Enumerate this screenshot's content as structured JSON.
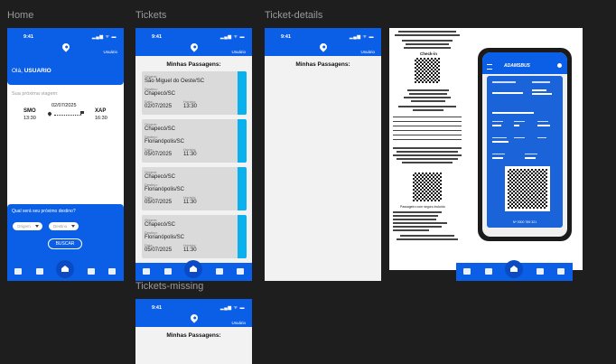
{
  "frames": {
    "home": "Home",
    "tickets": "Tickets",
    "ticket_details": "Ticket-details",
    "tickets_missing": "Tickets-missing"
  },
  "status": {
    "time": "9:41",
    "icons": "▂▄▆ ᯤ ▬"
  },
  "header": {
    "user_label": "Usuário"
  },
  "home": {
    "greeting": "Olá,",
    "user_name": "USUARIO",
    "next_trip_label": "Sua próxima viagem:",
    "trip": {
      "from": "SMO",
      "from_time": "13:30",
      "date": "02/07/2025",
      "to": "XAP",
      "to_time": "16:30"
    },
    "search_title": "Qual será seu próximo destino?",
    "origin_placeholder": "Origem",
    "destination_placeholder": "Destino",
    "search_button": "BUSCAR"
  },
  "tickets_page": {
    "title": "Minhas Passagens:",
    "labels": {
      "origin": "Origem:",
      "destination": "Destino:",
      "date": "Data:",
      "time": "Horário:"
    },
    "items": [
      {
        "origin": "São Miguel do Oeste/SC",
        "destination": "Chapecó/SC",
        "date": "02/07/2025",
        "time": "13:30"
      },
      {
        "origin": "Chapecó/SC",
        "destination": "Florianópolis/SC",
        "date": "05/07/2025",
        "time": "11:30"
      },
      {
        "origin": "Chapecó/SC",
        "destination": "Florianópolis/SC",
        "date": "05/07/2025",
        "time": "11:30"
      },
      {
        "origin": "Chapecó/SC",
        "destination": "Florianópolis/SC",
        "date": "05/07/2025",
        "time": "11:30"
      }
    ]
  },
  "details_page": {
    "title": "Minhas Passagens:"
  },
  "missing_page": {
    "title": "Minhas Passagens:"
  },
  "receipt": {
    "checkin": "Check-in",
    "boarding_notice": "Passageiro com seguro incluído"
  },
  "phone_ticket": {
    "brand": "ADAMSBUS",
    "number_text": "Nº 0000 789 321"
  },
  "colors": {
    "primary": "#0a5fe6",
    "accent": "#0ab1ef",
    "background": "#1e1e1e"
  }
}
